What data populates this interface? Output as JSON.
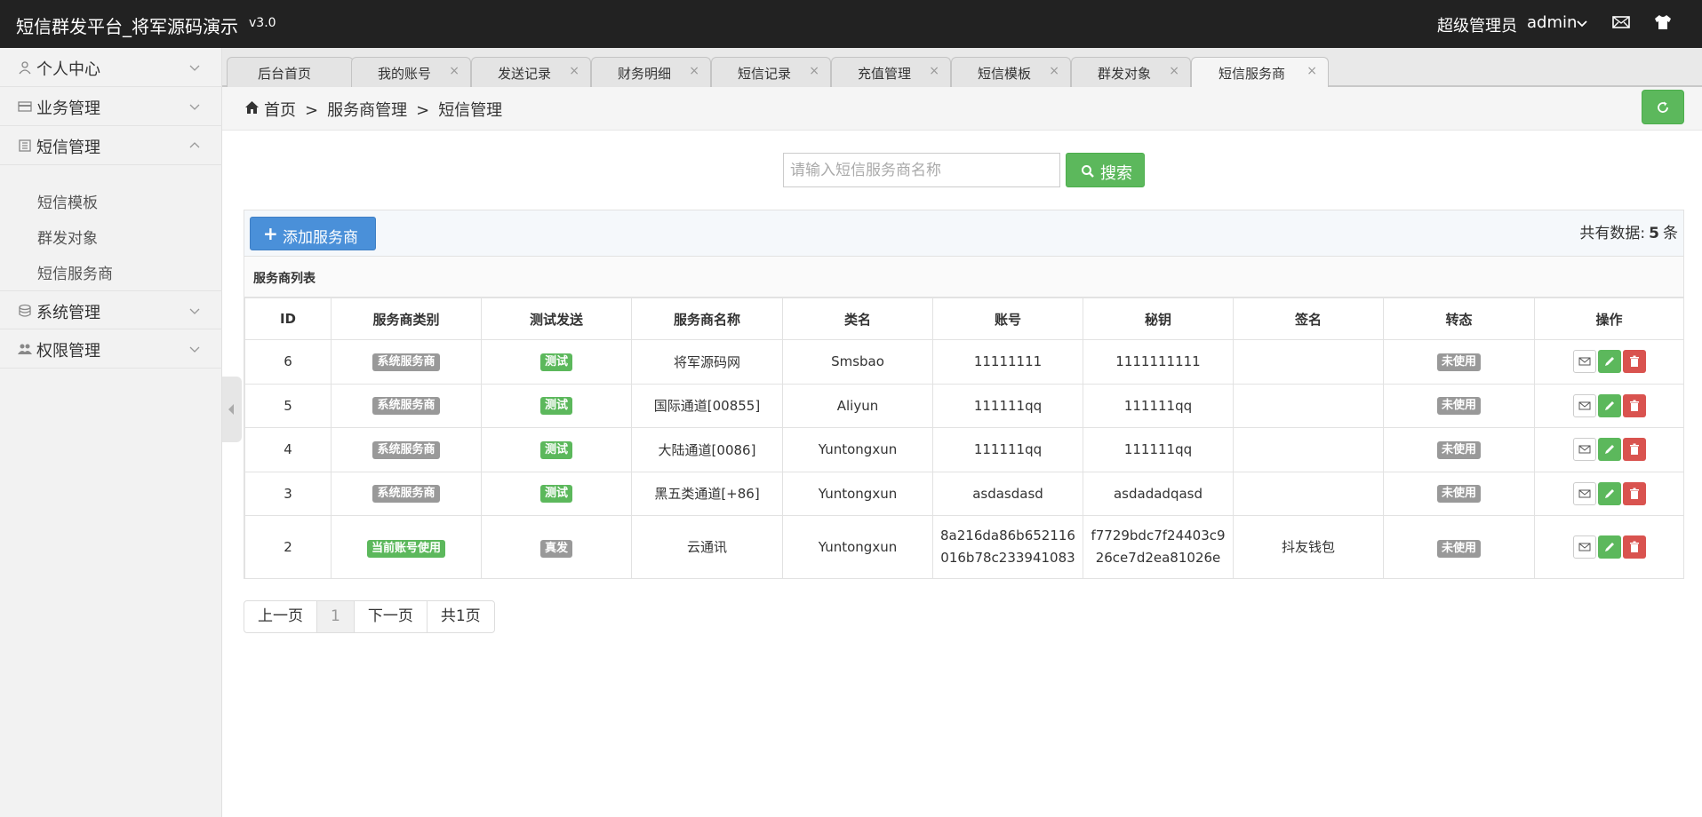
{
  "header": {
    "title": "短信群发平台_将军源码演示",
    "version": "v3.0",
    "user_role": "超级管理员",
    "user_name": "admin"
  },
  "sidebar": {
    "items": [
      {
        "label": "个人中心",
        "icon": "user-icon"
      },
      {
        "label": "业务管理",
        "icon": "card-icon"
      },
      {
        "label": "短信管理",
        "icon": "document-icon",
        "expanded": true
      },
      {
        "label": "系统管理",
        "icon": "database-icon"
      },
      {
        "label": "权限管理",
        "icon": "users-icon"
      }
    ],
    "sub_items": [
      "短信模板",
      "群发对象",
      "短信服务商"
    ]
  },
  "tabs": [
    "后台首页",
    "我的账号",
    "发送记录",
    "财务明细",
    "短信记录",
    "充值管理",
    "短信模板",
    "群发对象",
    "短信服务商"
  ],
  "active_tab": "短信服务商",
  "breadcrumb": [
    "首页",
    "服务商管理",
    "短信管理"
  ],
  "search": {
    "placeholder": "请输入短信服务商名称",
    "button_label": "搜索"
  },
  "toolbar": {
    "add_label": "添加服务商",
    "total_prefix": "共有数据:",
    "total_count": "5",
    "total_suffix": "条"
  },
  "list_title": "服务商列表",
  "table": {
    "columns": [
      "ID",
      "服务商类别",
      "测试发送",
      "服务商名称",
      "类名",
      "账号",
      "秘钥",
      "签名",
      "转态",
      "操作"
    ],
    "rows": [
      {
        "id": "6",
        "category": "系统服务商",
        "category_color": "#999999",
        "test": "测试",
        "test_color": "#5cb85c",
        "name": "将军源码网",
        "class": "Smsbao",
        "account": "11111111",
        "secret": "1111111111",
        "sign": "",
        "status": "未使用"
      },
      {
        "id": "5",
        "category": "系统服务商",
        "category_color": "#999999",
        "test": "测试",
        "test_color": "#5cb85c",
        "name": "国际通道[00855]",
        "class": "Aliyun",
        "account": "111111qq",
        "secret": "111111qq",
        "sign": "",
        "status": "未使用"
      },
      {
        "id": "4",
        "category": "系统服务商",
        "category_color": "#999999",
        "test": "测试",
        "test_color": "#5cb85c",
        "name": "大陆通道[0086]",
        "class": "Yuntongxun",
        "account": "111111qq",
        "secret": "111111qq",
        "sign": "",
        "status": "未使用"
      },
      {
        "id": "3",
        "category": "系统服务商",
        "category_color": "#999999",
        "test": "测试",
        "test_color": "#5cb85c",
        "name": "黑五类通道[+86]",
        "class": "Yuntongxun",
        "account": "asdasdasd",
        "secret": "asdadadqasd",
        "sign": "",
        "status": "未使用"
      },
      {
        "id": "2",
        "category": "当前账号使用",
        "category_color": "#5cb85c",
        "test": "真发",
        "test_color": "#999999",
        "name": "云通讯",
        "class": "Yuntongxun",
        "account_lines": [
          "8a216da86b652116",
          "016b78c233941083"
        ],
        "secret_lines": [
          "f7729bdc7f24403c9",
          "26ce7d2ea81026e"
        ],
        "sign": "抖友钱包",
        "status": "未使用"
      }
    ]
  },
  "pager": {
    "prev": "上一页",
    "current": "1",
    "next": "下一页",
    "total": "共1页"
  },
  "colors": {
    "topbar": "#222222",
    "success": "#5cb85c",
    "primary": "#4a90d9",
    "danger": "#d9534f",
    "muted_badge": "#999999"
  }
}
